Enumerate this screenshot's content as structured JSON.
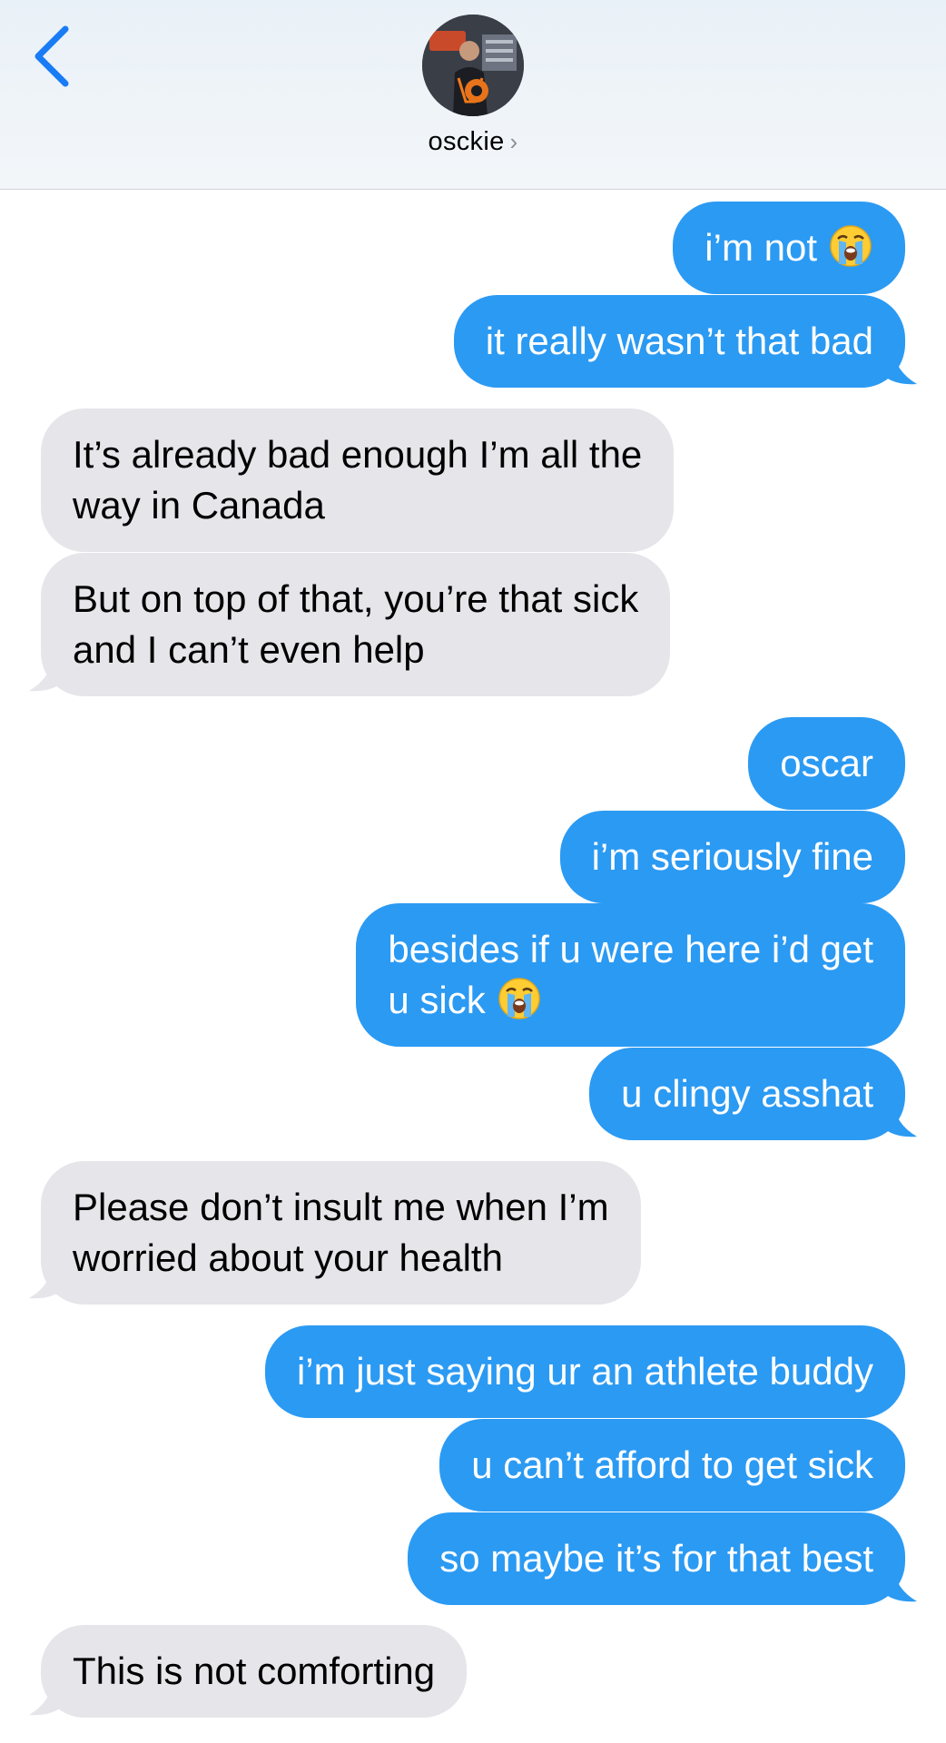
{
  "header": {
    "contact_name": "osckie",
    "chevron": "›",
    "back_icon": "chevron-left-icon"
  },
  "colors": {
    "sent_bubble": "#2b9af3",
    "received_bubble": "#e5e5ea",
    "back_accent": "#1a7cf5"
  },
  "messages": [
    {
      "dir": "sent",
      "lines": [
        "i’m not"
      ],
      "emoji": "loudly-crying-face"
    },
    {
      "dir": "sent",
      "lines": [
        "it really wasn’t that bad"
      ]
    },
    {
      "dir": "recv",
      "lines": [
        "It’s already bad enough I’m all the",
        "way in Canada"
      ]
    },
    {
      "dir": "recv",
      "lines": [
        "But on top of that, you’re that sick",
        "and I can’t even help"
      ]
    },
    {
      "dir": "sent",
      "lines": [
        "oscar"
      ]
    },
    {
      "dir": "sent",
      "lines": [
        "i’m seriously fine"
      ]
    },
    {
      "dir": "sent",
      "lines": [
        "besides if u were here i’d get",
        "u sick"
      ],
      "emoji": "loudly-crying-face"
    },
    {
      "dir": "sent",
      "lines": [
        "u clingy asshat"
      ]
    },
    {
      "dir": "recv",
      "lines": [
        "Please don’t insult me when I’m",
        "worried about your health"
      ]
    },
    {
      "dir": "sent",
      "lines": [
        "i’m just saying ur an athlete buddy"
      ]
    },
    {
      "dir": "sent",
      "lines": [
        "u can’t afford to get sick"
      ]
    },
    {
      "dir": "sent",
      "lines": [
        "so maybe it’s for that best"
      ]
    },
    {
      "dir": "recv",
      "lines": [
        "This is not comforting"
      ]
    }
  ]
}
